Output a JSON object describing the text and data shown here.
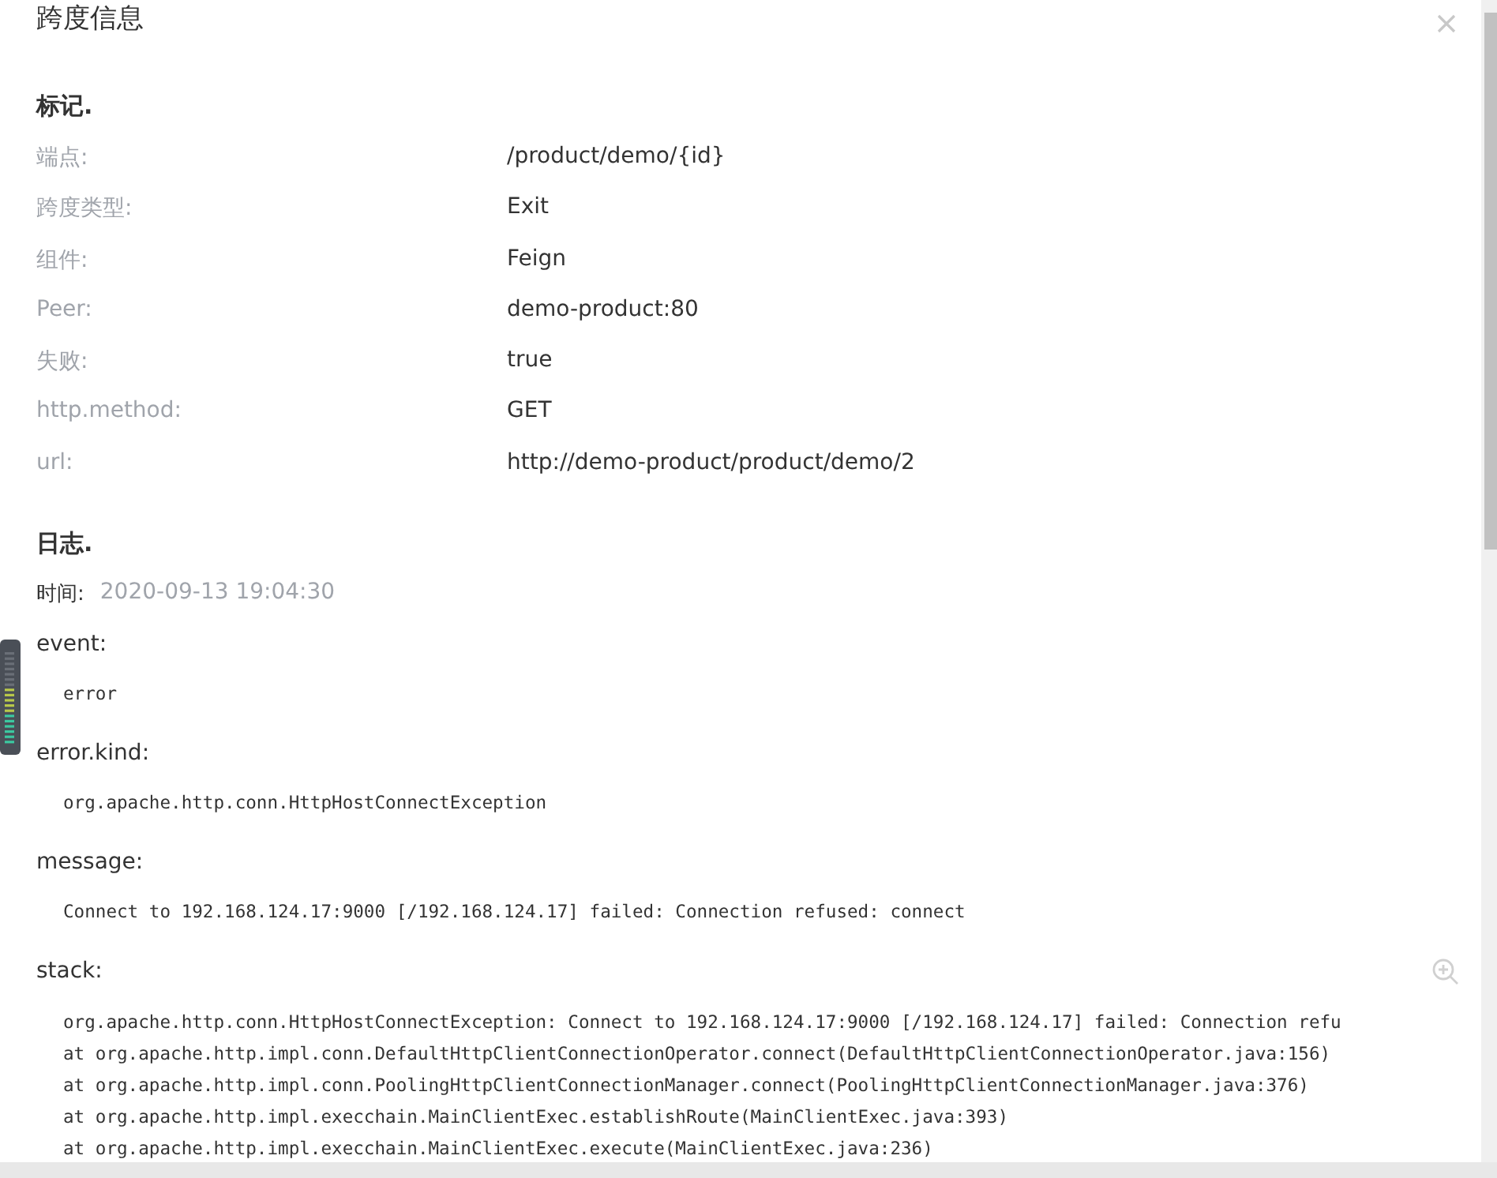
{
  "dialog": {
    "title": "跨度信息"
  },
  "tags": {
    "heading": "标记.",
    "rows": [
      {
        "label": "端点:",
        "value": "/product/demo/{id}"
      },
      {
        "label": "跨度类型:",
        "value": "Exit"
      },
      {
        "label": "组件:",
        "value": "Feign"
      },
      {
        "label": "Peer:",
        "value": "demo-product:80"
      },
      {
        "label": "失败:",
        "value": "true"
      },
      {
        "label": "http.method:",
        "value": "GET"
      },
      {
        "label": "url:",
        "value": "http://demo-product/product/demo/2"
      }
    ]
  },
  "logs": {
    "heading": "日志.",
    "time_label": "时间:",
    "time": "2020-09-13 19:04:30",
    "entries": [
      {
        "key": "event:",
        "lines": [
          "error"
        ]
      },
      {
        "key": "error.kind:",
        "lines": [
          "org.apache.http.conn.HttpHostConnectException"
        ]
      },
      {
        "key": "message:",
        "lines": [
          "Connect to 192.168.124.17:9000 [/192.168.124.17] failed: Connection refused: connect"
        ]
      },
      {
        "key": "stack:",
        "zoomable": true,
        "lines": [
          "org.apache.http.conn.HttpHostConnectException: Connect to 192.168.124.17:9000 [/192.168.124.17] failed: Connection refu",
          "at org.apache.http.impl.conn.DefaultHttpClientConnectionOperator.connect(DefaultHttpClientConnectionOperator.java:156)",
          "at org.apache.http.impl.conn.PoolingHttpClientConnectionManager.connect(PoolingHttpClientConnectionManager.java:376)",
          "at org.apache.http.impl.execchain.MainClientExec.establishRoute(MainClientExec.java:393)",
          "at org.apache.http.impl.execchain.MainClientExec.execute(MainClientExec.java:236)"
        ]
      }
    ]
  }
}
